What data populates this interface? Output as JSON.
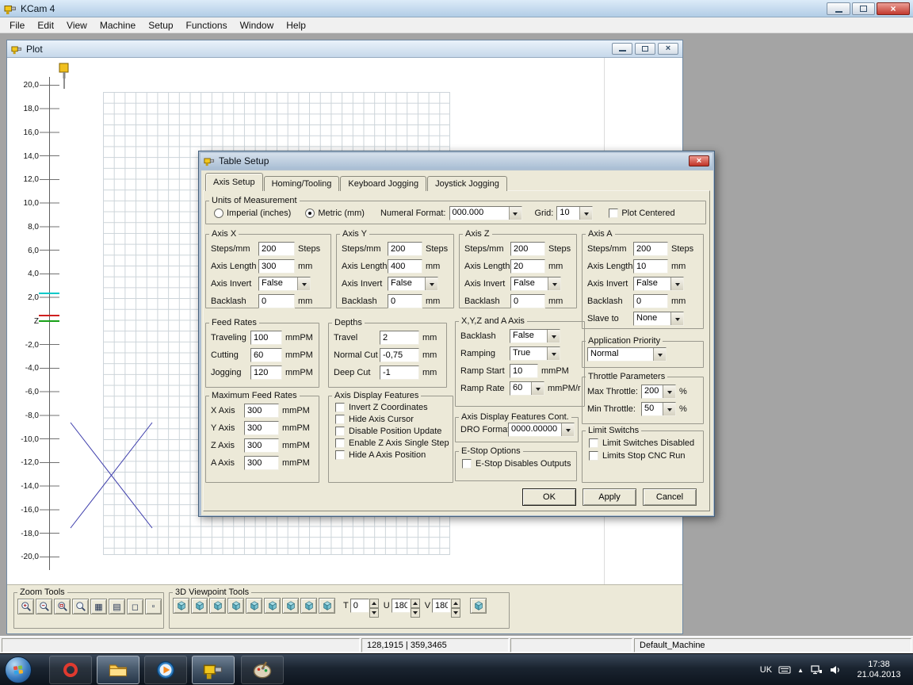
{
  "window": {
    "title": "KCam 4"
  },
  "menu": {
    "items": [
      "File",
      "Edit",
      "View",
      "Machine",
      "Setup",
      "Functions",
      "Window",
      "Help"
    ]
  },
  "plot": {
    "title": "Plot",
    "ruler": [
      "20,0",
      "18,0",
      "16,0",
      "14,0",
      "12,0",
      "10,0",
      "8,0",
      "6,0",
      "4,0",
      "2,0",
      "Z",
      "-2,0",
      "-4,0",
      "-6,0",
      "-8,0",
      "-10,0",
      "-12,0",
      "-14,0",
      "-16,0",
      "-18,0",
      "-20,0"
    ],
    "zoom_tools": {
      "legend": "Zoom Tools"
    },
    "viewpoint_tools": {
      "legend": "3D Viewpoint Tools",
      "t_label": "T",
      "t_value": "0",
      "u_label": "U",
      "u_value": "180",
      "v_label": "V",
      "v_value": "180"
    }
  },
  "dialog": {
    "title": "Table Setup",
    "tabs": [
      "Axis Setup",
      "Homing/Tooling",
      "Keyboard Jogging",
      "Joystick Jogging"
    ],
    "units": {
      "legend": "Units of Measurement",
      "imperial_label": "Imperial (inches)",
      "metric_label": "Metric (mm)",
      "selected": "metric",
      "numeral_format_label": "Numeral Format:",
      "numeral_format_value": "000.000",
      "grid_label": "Grid:",
      "grid_value": "10",
      "plot_centered_label": "Plot Centered"
    },
    "axes": [
      {
        "legend": "Axis X",
        "steps_label": "Steps/mm",
        "steps_value": "200",
        "steps_unit": "Steps",
        "length_label": "Axis Length",
        "length_value": "300",
        "length_unit": "mm",
        "invert_label": "Axis Invert",
        "invert_value": "False",
        "backlash_label": "Backlash",
        "backlash_value": "0",
        "backlash_unit": "mm"
      },
      {
        "legend": "Axis Y",
        "steps_label": "Steps/mm",
        "steps_value": "200",
        "steps_unit": "Steps",
        "length_label": "Axis Length",
        "length_value": "400",
        "length_unit": "mm",
        "invert_label": "Axis Invert",
        "invert_value": "False",
        "backlash_label": "Backlash",
        "backlash_value": "0",
        "backlash_unit": "mm"
      },
      {
        "legend": "Axis Z",
        "steps_label": "Steps/mm",
        "steps_value": "200",
        "steps_unit": "Steps",
        "length_label": "Axis Length",
        "length_value": "20",
        "length_unit": "mm",
        "invert_label": "Axis Invert",
        "invert_value": "False",
        "backlash_label": "Backlash",
        "backlash_value": "0",
        "backlash_unit": "mm"
      },
      {
        "legend": "Axis A",
        "steps_label": "Steps/mm",
        "steps_value": "200",
        "steps_unit": "Steps",
        "length_label": "Axis Length",
        "length_value": "10",
        "length_unit": "mm",
        "invert_label": "Axis Invert",
        "invert_value": "False",
        "backlash_label": "Backlash",
        "backlash_value": "0",
        "backlash_unit": "mm",
        "slave_label": "Slave to",
        "slave_value": "None"
      }
    ],
    "feed_rates": {
      "legend": "Feed Rates",
      "rows": [
        {
          "label": "Traveling",
          "value": "100",
          "unit": "mmPM"
        },
        {
          "label": "Cutting",
          "value": "60",
          "unit": "mmPM"
        },
        {
          "label": "Jogging",
          "value": "120",
          "unit": "mmPM"
        }
      ]
    },
    "depths": {
      "legend": "Depths",
      "rows": [
        {
          "label": "Travel",
          "value": "2",
          "unit": "mm"
        },
        {
          "label": "Normal Cut",
          "value": "-0,75",
          "unit": "mm"
        },
        {
          "label": "Deep Cut",
          "value": "-1",
          "unit": "mm"
        }
      ]
    },
    "xyza": {
      "legend": "X,Y,Z and A Axis",
      "backlash_label": "Backlash",
      "backlash_value": "False",
      "ramping_label": "Ramping",
      "ramping_value": "True",
      "ramp_start_label": "Ramp Start",
      "ramp_start_value": "10",
      "ramp_start_unit": "mmPM",
      "ramp_rate_label": "Ramp Rate",
      "ramp_rate_value": "60",
      "ramp_rate_unit": "mmPM/r"
    },
    "app_priority": {
      "legend": "Application Priority",
      "value": "Normal"
    },
    "throttle": {
      "legend": "Throttle Parameters",
      "max_label": "Max Throttle:",
      "max_value": "200",
      "max_unit": "%",
      "min_label": "Min Throttle:",
      "min_value": "50",
      "min_unit": "%"
    },
    "limit_switches": {
      "legend": "Limit Switchs",
      "options": [
        "Limit Switches Disabled",
        "Limits Stop CNC Run"
      ]
    },
    "max_feed_rates": {
      "legend": "Maximum Feed Rates",
      "rows": [
        {
          "label": "X Axis",
          "value": "300",
          "unit": "mmPM"
        },
        {
          "label": "Y Axis",
          "value": "300",
          "unit": "mmPM"
        },
        {
          "label": "Z Axis",
          "value": "300",
          "unit": "mmPM"
        },
        {
          "label": "A Axis",
          "value": "300",
          "unit": "mmPM"
        }
      ]
    },
    "display_features": {
      "legend": "Axis Display Features",
      "options": [
        "Invert Z Coordinates",
        "Hide Axis Cursor",
        "Disable Position Update",
        "Enable Z Axis Single Step",
        "Hide A Axis Position"
      ]
    },
    "display_features_cont": {
      "legend": "Axis Display Features Cont.",
      "dro_label": "DRO Format",
      "dro_value": "0000.00000"
    },
    "estop": {
      "legend": "E-Stop Options",
      "option": "E-Stop Disables Outputs"
    },
    "buttons": {
      "ok": "OK",
      "apply": "Apply",
      "cancel": "Cancel"
    }
  },
  "statusbar": {
    "coords": "128,1915 | 359,3465",
    "machine": "Default_Machine"
  },
  "taskbar": {
    "language": "UK",
    "time": "17:38",
    "date": "21.04.2013"
  }
}
